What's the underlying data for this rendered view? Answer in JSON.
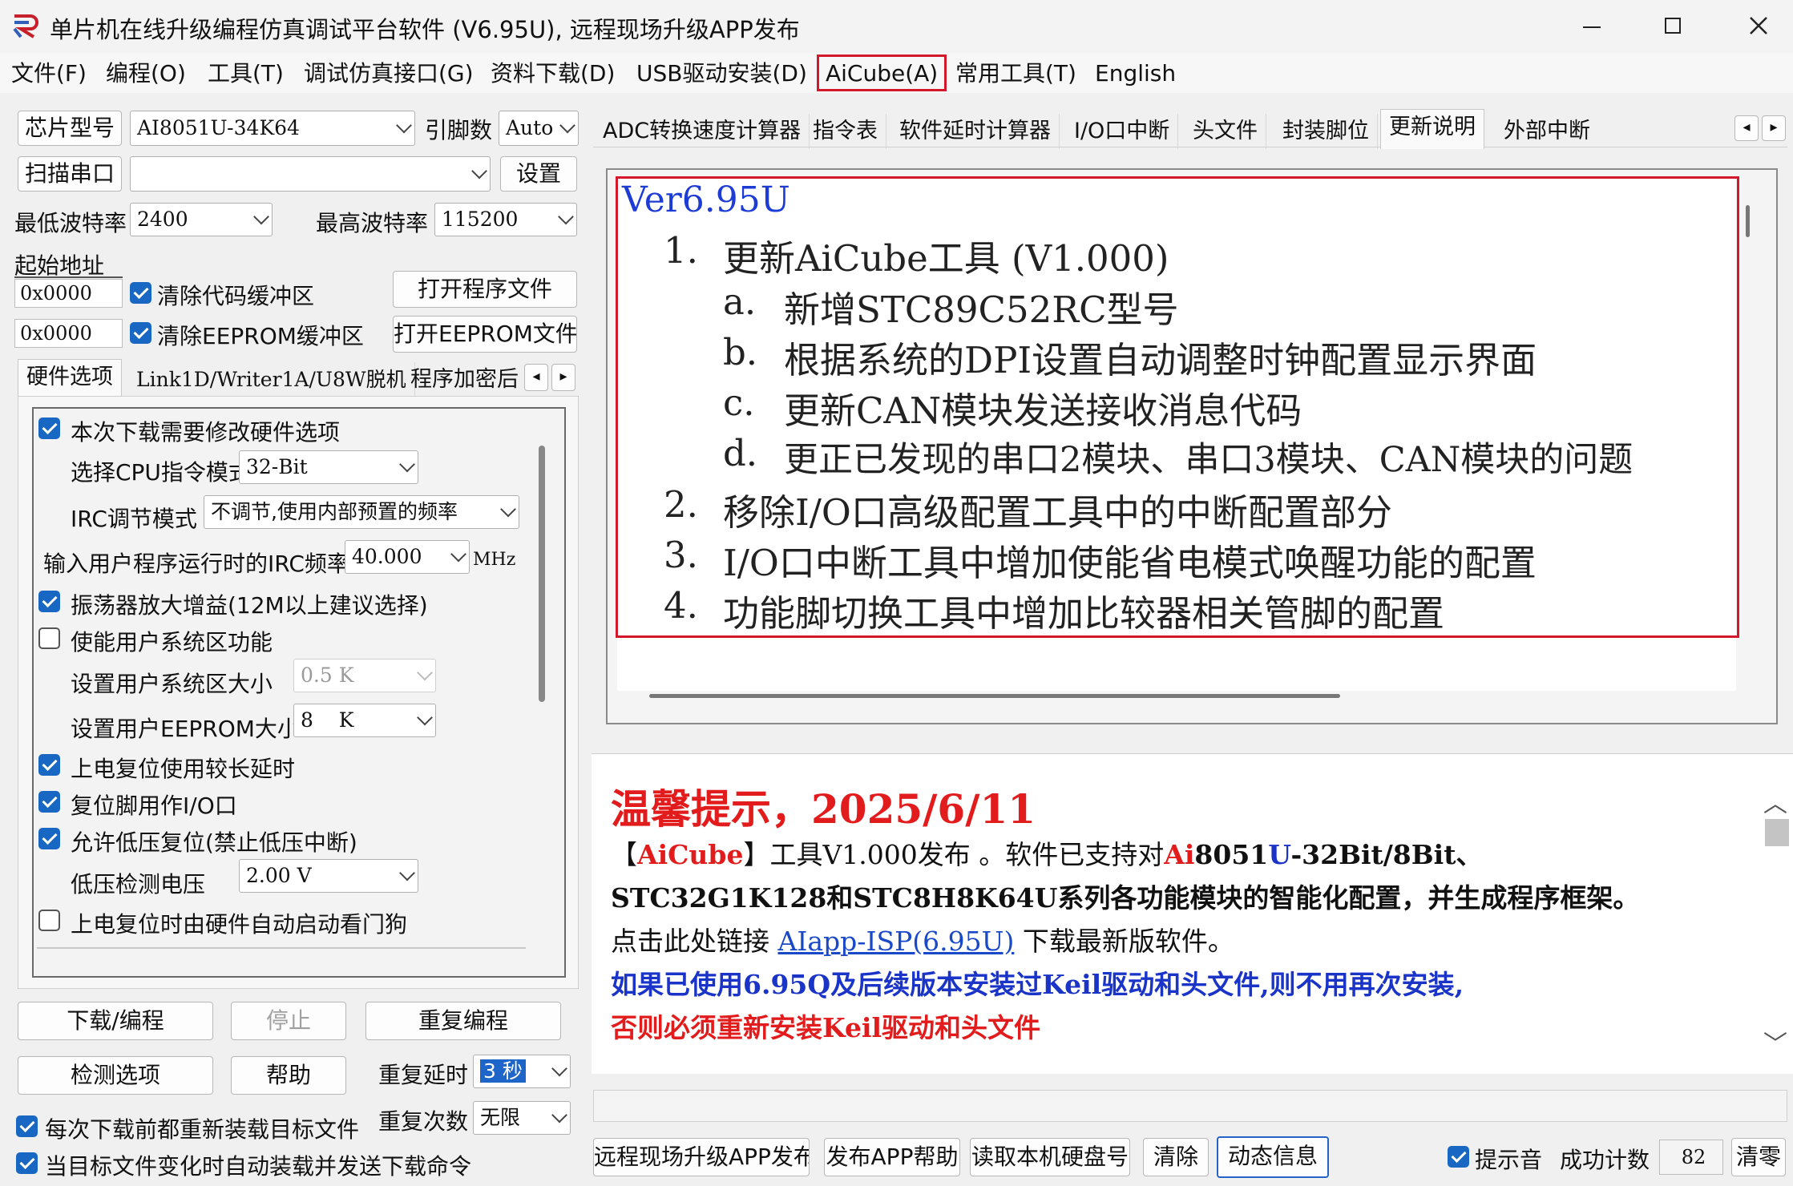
{
  "window": {
    "title": "单片机在线升级编程仿真调试平台软件 (V6.95U), 远程现场升级APP发布"
  },
  "menu": [
    "文件(F)",
    "编程(O)",
    "工具(T)",
    "调试仿真接口(G)",
    "资料下载(D)",
    "USB驱动安装(D)",
    "AiCube(A)",
    "常用工具(T)",
    "English"
  ],
  "left": {
    "chip_label": "芯片型号",
    "chip_value": "AI8051U-34K64",
    "pin_label": "引脚数",
    "pin_value": "Auto",
    "scan_label": "扫描串口",
    "scan_value": "",
    "settings_label": "设置",
    "min_baud_label": "最低波特率",
    "min_baud": "2400",
    "max_baud_label": "最高波特率",
    "max_baud": "115200",
    "start_addr_label": "起始地址",
    "addr1": "0x0000",
    "clear_code": "清除代码缓冲区",
    "open_program": "打开程序文件",
    "addr2": "0x0000",
    "clear_eeprom": "清除EEPROM缓冲区",
    "open_eeprom": "打开EEPROM文件",
    "tabs": [
      "硬件选项",
      "Link1D/Writer1A/U8W脱机",
      "程序加密后"
    ],
    "hw": {
      "modify_hw": "本次下载需要修改硬件选项",
      "cpu_mode_label": "选择CPU指令模式",
      "cpu_mode": "32-Bit",
      "irc_label": "IRC调节模式",
      "irc_value": "不调节,使用内部预置的频率",
      "freq_label": "输入用户程序运行时的IRC频率",
      "freq_value": "40.000",
      "freq_unit": "MHz",
      "osc_gain": "振荡器放大增益(12M以上建议选择)",
      "user_sys": "使能用户系统区功能",
      "user_sys_size_label": "设置用户系统区大小",
      "user_sys_size": "0.5 K",
      "user_eeprom_label": "设置用户EEPROM大小",
      "user_eeprom": "8    K",
      "power_reset_delay": "上电复位使用较长延时",
      "reset_pin_io": "复位脚用作I/O口",
      "low_volt_reset": "允许低压复位(禁止低压中断)",
      "low_volt_label": "低压检测电压",
      "low_volt": "2.00 V",
      "watchdog": "上电复位时由硬件自动启动看门狗"
    },
    "download": "下载/编程",
    "stop": "停止",
    "reprogram": "重复编程",
    "check_options": "检测选项",
    "help": "帮助",
    "repeat_delay_label": "重复延时",
    "repeat_delay": "3 秒",
    "repeat_count_label": "重复次数",
    "repeat_count": "无限",
    "reload_each": "每次下载前都重新装载目标文件",
    "auto_load": "当目标文件变化时自动装载并发送下载命令"
  },
  "right": {
    "tabs": [
      "ADC转换速度计算器",
      "指令表",
      "软件延时计算器",
      "I/O口中断",
      "头文件",
      "封装脚位",
      "更新说明",
      "外部中断"
    ],
    "active_tab": "更新说明",
    "update": {
      "version": "Ver6.95U",
      "items": [
        {
          "num": "1.",
          "text": "更新AiCube工具 (V1.000)",
          "sub": [
            {
              "num": "a.",
              "text": "新增STC89C52RC型号"
            },
            {
              "num": "b.",
              "text": "根据系统的DPI设置自动调整时钟配置显示界面"
            },
            {
              "num": "c.",
              "text": "更新CAN模块发送接收消息代码"
            },
            {
              "num": "d.",
              "text": "更正已发现的串口2模块、串口3模块、CAN模块的问题"
            }
          ]
        },
        {
          "num": "2.",
          "text": "移除I/O口高级配置工具中的中断配置部分"
        },
        {
          "num": "3.",
          "text": "I/O口中断工具中增加使能省电模式唤醒功能的配置"
        },
        {
          "num": "4.",
          "text": "功能脚切换工具中增加比较器相关管脚的配置"
        }
      ]
    },
    "notice": {
      "title": "温馨提示，2025/6/11",
      "l1_a": "【",
      "l1_b": "AiCube",
      "l1_c": "】工具V1.000发布 。软件已支持对",
      "l1_d": "Ai",
      "l1_e": "8051",
      "l1_f": "U",
      "l1_g": "-32Bit/8Bit、",
      "l2": "STC32G1K128和STC8H8K64U系列各功能模块的智能化配置，并生成程序框架。",
      "l3_a": "点击此处链接 ",
      "l3_link": "AIapp-ISP(6.95U)",
      "l3_b": " 下载最新版软件。",
      "l4": "如果已使用6.95Q及后续版本安装过Keil驱动和头文件,则不用再次安装,",
      "l5": "否则必须重新安装Keil驱动和头文件"
    },
    "bottom": {
      "remote": "远程现场升级APP发布",
      "publish_help": "发布APP帮助",
      "read_disk": "读取本机硬盘号",
      "clear": "清除",
      "dynamic": "动态信息",
      "sound": "提示音",
      "success_label": "成功计数",
      "success_count": "82",
      "reset": "清零"
    },
    "colors": {
      "red_box": "#d3182b",
      "link": "#1a49c8",
      "red_text": "#e21c1c",
      "blue_text": "#1a34c8"
    }
  }
}
